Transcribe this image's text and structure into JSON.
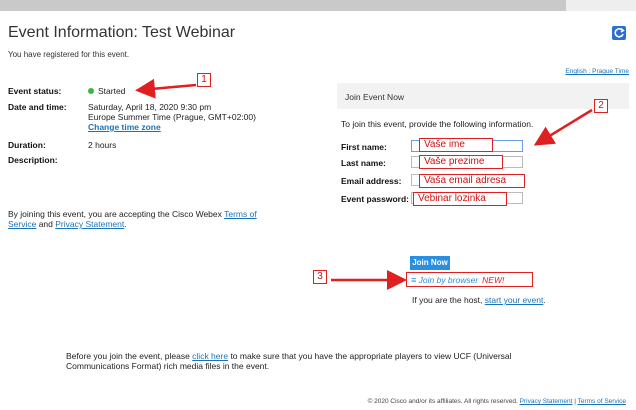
{
  "page": {
    "title": "Event Information: Test Webinar",
    "subtitle": "You have registered for this event.",
    "lang_link": "English : Prague Time"
  },
  "info": {
    "status_label": "Event status:",
    "status_value": "Started",
    "datetime_label": "Date and time:",
    "datetime_line1": "Saturday, April 18, 2020 9:30 pm",
    "datetime_line2": "Europe Summer Time (Prague, GMT+02:00)",
    "change_tz": "Change time zone",
    "duration_label": "Duration:",
    "duration_value": "2 hours",
    "description_label": "Description:"
  },
  "terms": {
    "prefix": "By joining this event, you are accepting the Cisco Webex ",
    "terms_link": "Terms of Service",
    "and": " and ",
    "privacy_link": "Privacy Statement",
    "suffix": "."
  },
  "join": {
    "header": "Join Event Now",
    "intro": "To join this event, provide the following information.",
    "first_name_label": "First name:",
    "last_name_label": "Last name:",
    "email_label": "Email address:",
    "password_label": "Event password:",
    "join_now": "Join Now",
    "join_browser": "Join by browser",
    "new_tag": "NEW!",
    "host_prefix": "If you are the host, ",
    "host_link": "start your event",
    "host_suffix": "."
  },
  "annotations": {
    "badge1": "1",
    "badge2": "2",
    "badge3": "3",
    "first_name": "Vaše ime",
    "last_name": "Vaše prezime",
    "email": "Vaša email adresa",
    "password": "Vebinar lozinka"
  },
  "ucf": {
    "prefix": "Before you join the event, please ",
    "link": "click here",
    "suffix": " to make sure that you have the appropriate players to view UCF (Universal Communications Format) rich media files in the event."
  },
  "footer": {
    "copyright": "© 2020 Cisco and/or its affiliates. All rights reserved.",
    "privacy": "Privacy Statement",
    "sep": " | ",
    "terms": "Terms of Service"
  },
  "colors": {
    "accent": "#2b8fe0",
    "link": "#1a73b8",
    "annotation": "#e02020",
    "status_green": "#3cb54a"
  }
}
